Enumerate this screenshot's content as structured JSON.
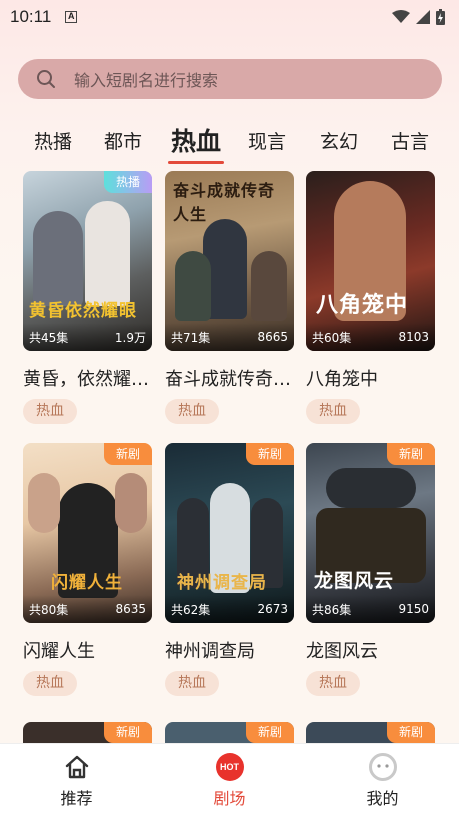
{
  "status": {
    "time": "10:11",
    "notif": "A"
  },
  "search": {
    "placeholder": "输入短剧名进行搜索"
  },
  "tabs": [
    {
      "label": "热播"
    },
    {
      "label": "都市"
    },
    {
      "label": "热血",
      "active": true
    },
    {
      "label": "现言"
    },
    {
      "label": "玄幻"
    },
    {
      "label": "古言"
    }
  ],
  "cards": [
    {
      "title": "黄昏，依然耀…",
      "poster_text": "黄昏依然耀眼",
      "episodes": "共45集",
      "views": "1.9万",
      "badge": "热播",
      "genre": "热血"
    },
    {
      "title": "奋斗成就传奇…",
      "poster_text": "奋斗成就传奇人生",
      "episodes": "共71集",
      "views": "8665",
      "badge": "",
      "genre": "热血"
    },
    {
      "title": "八角笼中",
      "poster_text": "八角笼中",
      "episodes": "共60集",
      "views": "8103",
      "badge": "",
      "genre": "热血"
    },
    {
      "title": "闪耀人生",
      "poster_text": "闪耀人生",
      "episodes": "共80集",
      "views": "8635",
      "badge": "新剧",
      "genre": "热血"
    },
    {
      "title": "神州调查局",
      "poster_text": "神州调查局",
      "episodes": "共62集",
      "views": "2673",
      "badge": "新剧",
      "genre": "热血"
    },
    {
      "title": "龙图风云",
      "poster_text": "龙图风云",
      "episodes": "共86集",
      "views": "9150",
      "badge": "新剧",
      "genre": "热血"
    }
  ],
  "partial_badges": [
    "新剧",
    "新剧",
    "新剧"
  ],
  "nav": [
    {
      "label": "推荐",
      "icon": "home-icon"
    },
    {
      "label": "剧场",
      "icon": "hot-icon",
      "icon_text": "HOT",
      "active": true
    },
    {
      "label": "我的",
      "icon": "profile-icon"
    }
  ],
  "colors": {
    "accent": "#e34a3a",
    "search_bg": "#d9a9a8",
    "tag_bg": "#f7e2d6",
    "badge_new": "#f88d3d"
  }
}
